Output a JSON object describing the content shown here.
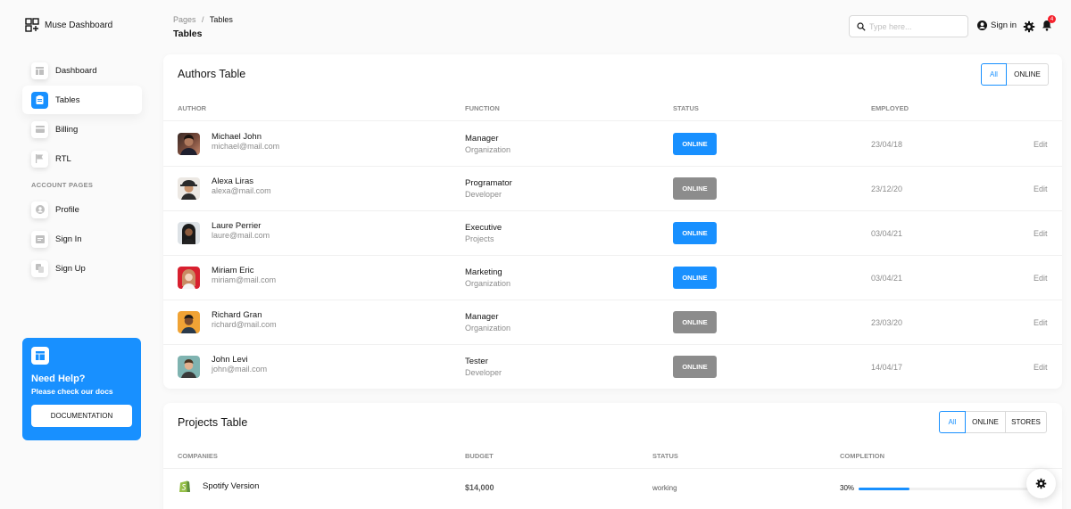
{
  "brand": {
    "name": "Muse Dashboard"
  },
  "sidebar": {
    "items": [
      {
        "label": "Dashboard",
        "icon": "dashboard-icon"
      },
      {
        "label": "Tables",
        "icon": "tables-icon"
      },
      {
        "label": "Billing",
        "icon": "billing-icon"
      },
      {
        "label": "RTL",
        "icon": "flag-icon"
      }
    ],
    "section": "ACCOUNT PAGES",
    "account_items": [
      {
        "label": "Profile",
        "icon": "profile-icon"
      },
      {
        "label": "Sign In",
        "icon": "sign-in-icon"
      },
      {
        "label": "Sign Up",
        "icon": "sign-up-icon"
      }
    ],
    "help": {
      "title": "Need Help?",
      "subtitle": "Please check our docs",
      "button": "DOCUMENTATION"
    }
  },
  "header": {
    "breadcrumb_root": "Pages",
    "breadcrumb_sep": "/",
    "breadcrumb_current": "Tables",
    "title": "Tables",
    "search_placeholder": "Type here...",
    "signin": "Sign in",
    "notifications": "4"
  },
  "authors": {
    "title": "Authors Table",
    "filters": [
      "All",
      "ONLINE"
    ],
    "columns": [
      "AUTHOR",
      "FUNCTION",
      "STATUS",
      "EMPLOYED"
    ],
    "rows": [
      {
        "name": "Michael John",
        "email": "michael@mail.com",
        "function": "Manager",
        "dept": "Organization",
        "status": "ONLINE",
        "online": true,
        "employed": "23/04/18",
        "action": "Edit"
      },
      {
        "name": "Alexa Liras",
        "email": "alexa@mail.com",
        "function": "Programator",
        "dept": "Developer",
        "status": "ONLINE",
        "online": false,
        "employed": "23/12/20",
        "action": "Edit"
      },
      {
        "name": "Laure Perrier",
        "email": "laure@mail.com",
        "function": "Executive",
        "dept": "Projects",
        "status": "ONLINE",
        "online": true,
        "employed": "03/04/21",
        "action": "Edit"
      },
      {
        "name": "Miriam Eric",
        "email": "miriam@mail.com",
        "function": "Marketing",
        "dept": "Organization",
        "status": "ONLINE",
        "online": true,
        "employed": "03/04/21",
        "action": "Edit"
      },
      {
        "name": "Richard Gran",
        "email": "richard@mail.com",
        "function": "Manager",
        "dept": "Organization",
        "status": "ONLINE",
        "online": false,
        "employed": "23/03/20",
        "action": "Edit"
      },
      {
        "name": "John Levi",
        "email": "john@mail.com",
        "function": "Tester",
        "dept": "Developer",
        "status": "ONLINE",
        "online": false,
        "employed": "14/04/17",
        "action": "Edit"
      }
    ]
  },
  "projects": {
    "title": "Projects Table",
    "filters": [
      "All",
      "ONLINE",
      "STORES"
    ],
    "columns": [
      "COMPANIES",
      "BUDGET",
      "STATUS",
      "COMPLETION"
    ],
    "rows": [
      {
        "company": "Spotify Version",
        "icon": "shopify-icon",
        "budget": "$14,000",
        "status": "working",
        "completion": "30%",
        "completion_value": 30
      }
    ]
  },
  "colors": {
    "primary": "#1890ff",
    "online": "#1890ff",
    "offline": "#8c8c8c",
    "badge": "#f5222d"
  }
}
